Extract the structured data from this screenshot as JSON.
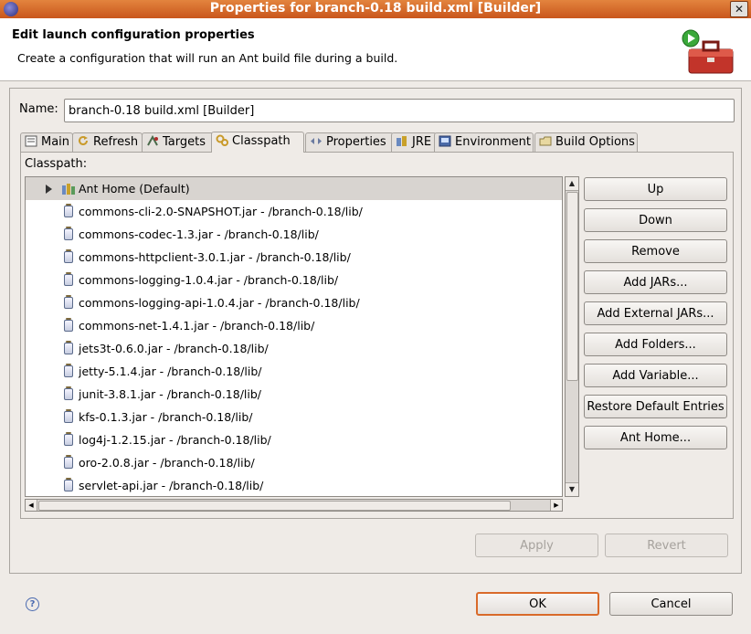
{
  "window": {
    "title": "Properties for branch-0.18 build.xml [Builder]",
    "close_glyph": "✕"
  },
  "header": {
    "heading": "Edit launch configuration properties",
    "description": "Create a configuration that will run an Ant build file during a build.",
    "icon": "ant-toolbox-icon"
  },
  "name_field": {
    "label": "Name:",
    "value": "branch-0.18 build.xml [Builder]"
  },
  "tabs": [
    {
      "label": "Main",
      "icon": "main-icon"
    },
    {
      "label": "Refresh",
      "icon": "refresh-icon"
    },
    {
      "label": "Targets",
      "icon": "targets-icon"
    },
    {
      "label": "Classpath",
      "icon": "classpath-icon",
      "active": true
    },
    {
      "label": "Properties",
      "icon": "properties-icon"
    },
    {
      "label": "JRE",
      "icon": "jre-icon"
    },
    {
      "label": "Environment",
      "icon": "environment-icon"
    },
    {
      "label": "Build Options",
      "icon": "build-options-icon"
    }
  ],
  "classpath": {
    "label": "Classpath:",
    "entries": [
      {
        "text": "Ant Home (Default)",
        "type": "ant-home"
      },
      {
        "text": "commons-cli-2.0-SNAPSHOT.jar - /branch-0.18/lib/",
        "type": "jar"
      },
      {
        "text": "commons-codec-1.3.jar - /branch-0.18/lib/",
        "type": "jar"
      },
      {
        "text": "commons-httpclient-3.0.1.jar - /branch-0.18/lib/",
        "type": "jar"
      },
      {
        "text": "commons-logging-1.0.4.jar - /branch-0.18/lib/",
        "type": "jar"
      },
      {
        "text": "commons-logging-api-1.0.4.jar - /branch-0.18/lib/",
        "type": "jar"
      },
      {
        "text": "commons-net-1.4.1.jar - /branch-0.18/lib/",
        "type": "jar"
      },
      {
        "text": "jets3t-0.6.0.jar - /branch-0.18/lib/",
        "type": "jar"
      },
      {
        "text": "jetty-5.1.4.jar - /branch-0.18/lib/",
        "type": "jar"
      },
      {
        "text": "junit-3.8.1.jar - /branch-0.18/lib/",
        "type": "jar"
      },
      {
        "text": "kfs-0.1.3.jar - /branch-0.18/lib/",
        "type": "jar"
      },
      {
        "text": "log4j-1.2.15.jar - /branch-0.18/lib/",
        "type": "jar"
      },
      {
        "text": "oro-2.0.8.jar - /branch-0.18/lib/",
        "type": "jar"
      },
      {
        "text": "servlet-api.jar - /branch-0.18/lib/",
        "type": "jar"
      }
    ]
  },
  "side_buttons": {
    "up": "Up",
    "down": "Down",
    "remove": "Remove",
    "add_jars": "Add JARs...",
    "add_external_jars": "Add External JARs...",
    "add_folders": "Add Folders...",
    "add_variable": "Add Variable...",
    "restore_default": "Restore Default Entries",
    "ant_home": "Ant Home..."
  },
  "panel_buttons": {
    "apply": "Apply",
    "revert": "Revert"
  },
  "dialog_buttons": {
    "ok": "OK",
    "cancel": "Cancel"
  },
  "help_glyph": "?",
  "colors": {
    "title_bar": "#d2692a",
    "default_button_border": "#d96a2a",
    "selection": "#d8d4d0"
  }
}
